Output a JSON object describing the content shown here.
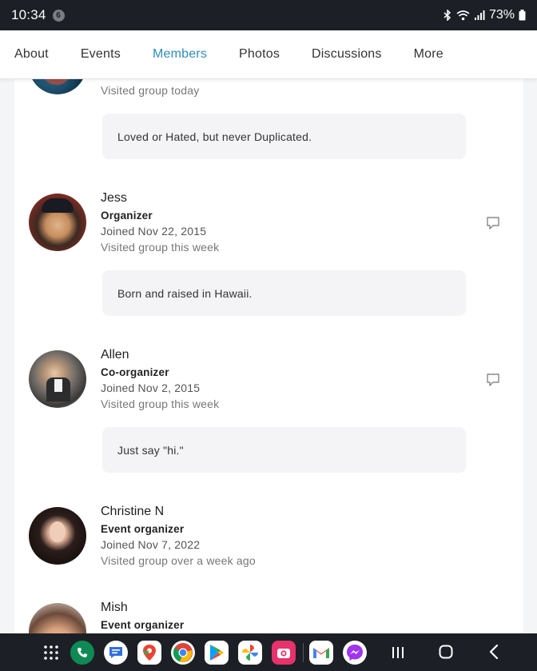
{
  "status": {
    "time": "10:34",
    "notif_count": "6",
    "battery": "73%"
  },
  "nav": {
    "tabs": [
      "About",
      "Events",
      "Members",
      "Photos",
      "Discussions",
      "More"
    ],
    "active": "Members"
  },
  "members": [
    {
      "name": "",
      "role": "",
      "joined": "",
      "visited": "Visited group today",
      "bio": "Loved or Hated, but never Duplicated."
    },
    {
      "name": "Jess",
      "role": "Organizer",
      "joined": "Joined Nov 22, 2015",
      "visited": "Visited group this week",
      "bio": "Born and raised in Hawaii."
    },
    {
      "name": "Allen",
      "role": "Co-organizer",
      "joined": "Joined Nov 2, 2015",
      "visited": "Visited group this week",
      "bio": "Just say \"hi.\""
    },
    {
      "name": "Christine N",
      "role": "Event organizer",
      "joined": "Joined Nov 7, 2022",
      "visited": "Visited group over a week ago",
      "bio": ""
    },
    {
      "name": "Mish",
      "role": "Event organizer",
      "joined": "",
      "visited": "",
      "bio": ""
    }
  ],
  "dock_apps": [
    "app-drawer",
    "phone",
    "messages",
    "maps",
    "chrome",
    "play-store",
    "photos",
    "instagram-camera",
    "gmail",
    "messenger"
  ],
  "colors": {
    "active_tab": "#2f8cba",
    "status_bar": "#1c2026",
    "bio_bg": "#f4f4f6"
  }
}
